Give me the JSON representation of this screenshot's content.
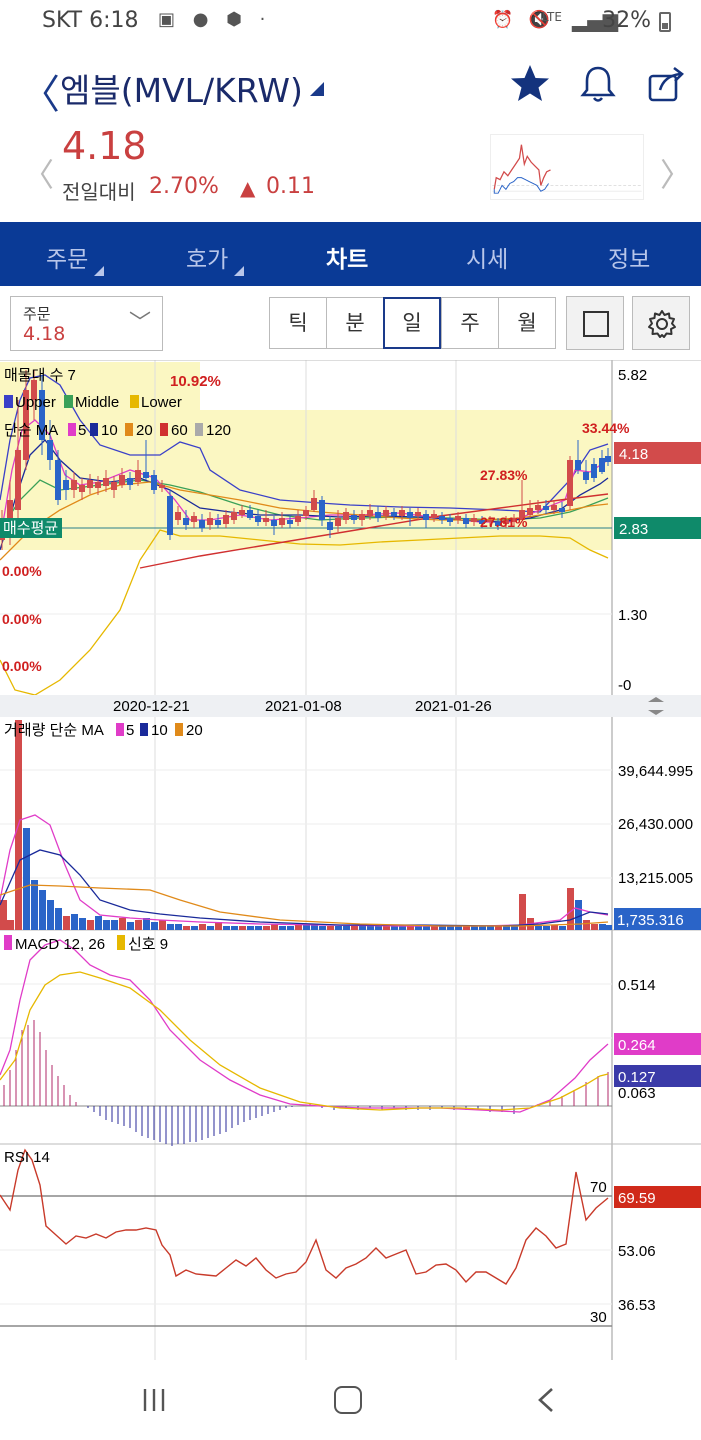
{
  "status_bar": {
    "carrier_time": "SKT 6:18",
    "battery_pct": "32%",
    "net_label": "LTE"
  },
  "header": {
    "title": "엠블(MVL/KRW)"
  },
  "quote": {
    "price": "4.18",
    "compare_label": "전일대비",
    "change_pct": "2.70%",
    "change_arrow": "▲",
    "change_value": "0.11"
  },
  "tabs": [
    "주문",
    "호가",
    "차트",
    "시세",
    "정보"
  ],
  "active_tab": "차트",
  "selector": {
    "label": "주문",
    "value": "4.18"
  },
  "periods": [
    "틱",
    "분",
    "일",
    "주",
    "월"
  ],
  "active_period": "일",
  "colors": {
    "up": "#d24b4b",
    "down": "#2a64c8",
    "accent": "#0a3a96"
  },
  "price_panel": {
    "title_line1": "매물대 수 7",
    "title_pct": "10.92%",
    "bb_legend": [
      "Upper",
      "Middle",
      "Lower"
    ],
    "ma_legend_prefix": "단순 MA",
    "ma_legend": [
      "5",
      "10",
      "20",
      "60",
      "120"
    ],
    "avg_label": "매수평균",
    "pct_labels": [
      "0.00%",
      "0.00%",
      "0.00%",
      "33.44%",
      "27.83%",
      "27.81%"
    ],
    "y_ticks": [
      "5.82",
      "1.30",
      "-0"
    ],
    "current_tag": "4.18",
    "avg_tag": "2.83",
    "dates": [
      "2020-12-21",
      "2021-01-08",
      "2021-01-26"
    ]
  },
  "volume_panel": {
    "title": "거래량 단순 MA",
    "ma_legend": [
      "5",
      "10",
      "20"
    ],
    "y_ticks": [
      "39,644.995",
      "26,430.000",
      "13,215.005"
    ],
    "current_tag": "1,735.316"
  },
  "macd_panel": {
    "title": "MACD 12, 26",
    "signal_label": "신호 9",
    "y_ticks": [
      "0.514",
      "0.063"
    ],
    "macd_tag": "0.264",
    "signal_tag": "0.127"
  },
  "rsi_panel": {
    "title": "RSI 14",
    "y_ticks": [
      "70",
      "53.06",
      "36.53",
      "30"
    ],
    "current_tag": "69.59"
  }
}
